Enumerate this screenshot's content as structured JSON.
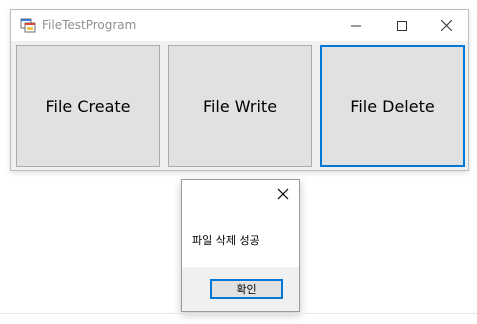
{
  "main_window": {
    "title": "FileTestProgram",
    "title_color": "#8f8f8f",
    "icons": {
      "app": "app-form-icon",
      "minimize": "minimize-icon",
      "maximize": "maximize-icon",
      "close": "close-icon"
    },
    "buttons": {
      "create_label": "File Create",
      "write_label": "File Write",
      "delete_label": "File Delete"
    },
    "focus_color": "#0078d7"
  },
  "message_box": {
    "message": "파일 삭제 성공",
    "ok_label": "확인",
    "close_icon": "close-icon"
  }
}
